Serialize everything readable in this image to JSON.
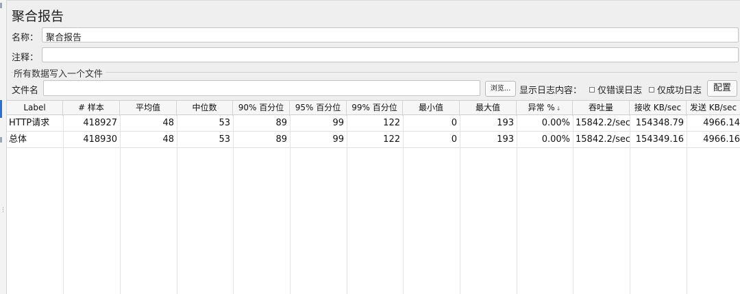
{
  "panel": {
    "title": "聚合报告",
    "name_label": "名称：",
    "name_value": "聚合报告",
    "comment_label": "注释：",
    "comment_value": "",
    "group_title": "所有数据写入一个文件",
    "file_label": "文件名",
    "file_value": "",
    "browse_label": "浏览...",
    "log_content_label": "显示日志内容：",
    "errors_only_label": "仅错误日志",
    "success_only_label": "仅成功日志",
    "config_label": "配置"
  },
  "table": {
    "headers": [
      "Label",
      "# 样本",
      "平均值",
      "中位数",
      "90% 百分位",
      "95% 百分位",
      "99% 百分位",
      "最小值",
      "最大值",
      "异常 %",
      "吞吐量",
      "接收 KB/sec",
      "发送 KB/sec"
    ],
    "sort_icon": "↓",
    "rows": [
      [
        "HTTP请求",
        "418927",
        "48",
        "53",
        "89",
        "99",
        "122",
        "0",
        "193",
        "0.00%",
        "15842.2/sec",
        "154348.79",
        "4966.14"
      ],
      [
        "总体",
        "418930",
        "48",
        "53",
        "89",
        "99",
        "122",
        "0",
        "193",
        "0.00%",
        "15842.2/sec",
        "154349.16",
        "4966.16"
      ]
    ]
  }
}
